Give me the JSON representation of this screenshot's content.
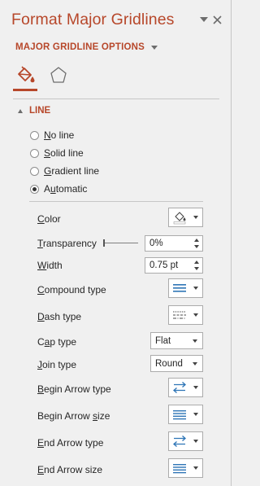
{
  "pane": {
    "title": "Format Major Gridlines",
    "options_header": "MAJOR GRIDLINE OPTIONS",
    "tabs": [
      {
        "name": "Fill & Line",
        "icon": "paint-bucket-icon",
        "selected": true
      },
      {
        "name": "Effects",
        "icon": "pentagon-icon",
        "selected": false
      }
    ]
  },
  "line_section": {
    "header": "LINE",
    "fill_options": [
      {
        "label": "No line",
        "key": "N",
        "rest": "o line",
        "selected": false
      },
      {
        "label": "Solid line",
        "key": "S",
        "rest": "olid line",
        "selected": false
      },
      {
        "label": "Gradient line",
        "key": "G",
        "rest": "radient line",
        "selected": false
      },
      {
        "label": "Automatic",
        "key": "u",
        "pre": "A",
        "rest": "tomatic",
        "selected": true
      }
    ],
    "properties": {
      "color": {
        "label": "Color",
        "pre": "",
        "key": "C",
        "rest": "olor",
        "icon": "outline-color-icon"
      },
      "transparency": {
        "label": "Transparency",
        "key": "T",
        "rest": "ransparency",
        "value": "0%",
        "slider_fraction": 0
      },
      "width": {
        "label": "Width",
        "key": "W",
        "rest": "idth",
        "value": "0.75 pt"
      },
      "compound_type": {
        "label": "Compound type",
        "key": "C",
        "rest": "ompound type",
        "icon": "compound-lines-icon"
      },
      "dash_type": {
        "label": "Dash type",
        "key": "D",
        "rest": "ash type",
        "icon": "dash-lines-icon"
      },
      "cap_type": {
        "label": "Cap type",
        "pre": "C",
        "key": "a",
        "rest": "p type",
        "value": "Flat"
      },
      "join_type": {
        "label": "Join type",
        "key": "J",
        "rest": "oin type",
        "value": "Round"
      },
      "begin_arrow_type": {
        "label": "Begin Arrow type",
        "key": "B",
        "rest": "egin Arrow type",
        "icon": "arrow-type-icon"
      },
      "begin_arrow_size": {
        "label": "Begin Arrow size",
        "pre": "Begin Arrow ",
        "key": "s",
        "rest": "ize",
        "icon": "arrow-size-icon"
      },
      "end_arrow_type": {
        "label": "End Arrow type",
        "key": "E",
        "rest": "nd Arrow type",
        "icon": "arrow-type-icon"
      },
      "end_arrow_size": {
        "label": "End Arrow size",
        "key": "E",
        "rest": "nd Arrow size",
        "icon": "arrow-size-icon"
      }
    }
  },
  "colors": {
    "accent": "#b7472a",
    "panel_bg": "#f0f0f0",
    "icon_blue": "#2e75b6"
  }
}
